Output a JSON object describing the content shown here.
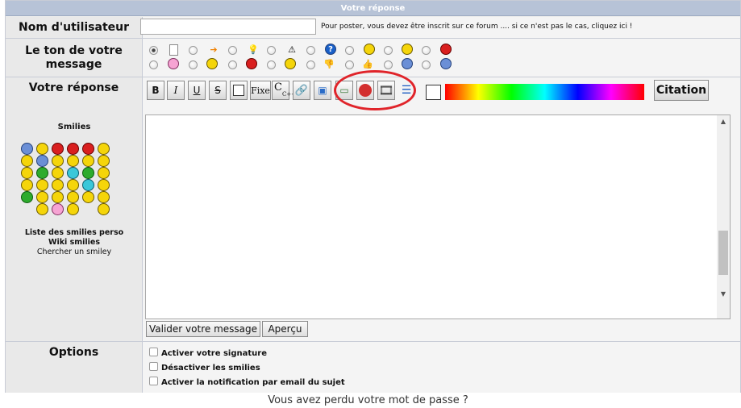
{
  "header": {
    "title": "Votre réponse"
  },
  "username": {
    "label": "Nom d'utilisateur",
    "value": "",
    "hint": "Pour poster, vous devez être inscrit sur ce forum .... si ce n'est pas le cas, cliquez ici !"
  },
  "tone": {
    "label_line1": "Le ton de votre",
    "label_line2": "message",
    "icons_row1": [
      "none",
      "page-icon",
      "arrow-right-icon",
      "lightbulb-icon",
      "warning-icon",
      "question-icon",
      "smile-icon",
      "angry-icon"
    ],
    "icons_row2": [
      "pink-sad-icon",
      "grin-icon",
      "red-mad-icon",
      "wink-icon",
      "thumbs-down-icon",
      "thumbs-up-icon",
      "confused-icon",
      "blue-icon"
    ],
    "selected": "none"
  },
  "reply": {
    "label": "Votre réponse",
    "toolbar": {
      "bold": "B",
      "italic": "I",
      "underline": "U",
      "strike": "S",
      "fixe": "Fixe",
      "code": "C",
      "code_sub": "C++",
      "citation": "Citation"
    },
    "textarea_value": ""
  },
  "smilies": {
    "title": "Smilies",
    "list_perso": "Liste des smilies perso",
    "wiki": "Wiki smilies",
    "search": "Chercher un smiley",
    "grid": [
      [
        "blue",
        "yellow",
        "red",
        "red",
        "red",
        "yellow"
      ],
      [
        "yellow",
        "blue",
        "yellow",
        "yellow",
        "yellow",
        "yellow"
      ],
      [
        "yellow",
        "green",
        "yellow",
        "cyan",
        "green",
        "yellow"
      ],
      [
        "yellow",
        "yellow",
        "yellow",
        "yellow",
        "cyan",
        "yellow"
      ],
      [
        "green",
        "yellow",
        "yellow",
        "yellow",
        "yellow",
        "yellow"
      ],
      [
        "",
        "yellow",
        "pink",
        "yellow",
        "",
        "yellow"
      ]
    ]
  },
  "actions": {
    "submit": "Valider votre message",
    "preview": "Aperçu"
  },
  "options": {
    "label": "Options",
    "signature": "Activer votre signature",
    "disable_smilies": "Désactiver les smilies",
    "notify": "Activer la notification par email du sujet"
  },
  "footer": {
    "lost_password": "Vous avez perdu votre mot de passe ?"
  },
  "colors": {
    "header_bg": "#b7c3d7",
    "highlight_circle": "#e0242a"
  }
}
